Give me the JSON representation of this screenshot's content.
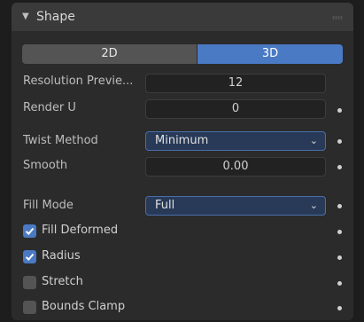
{
  "panel": {
    "title": "Shape",
    "icons": {
      "collapse": "triangle-down-icon",
      "drag": "grip-icon"
    }
  },
  "dimension_toggle": {
    "option_2d": "2D",
    "option_3d": "3D",
    "selected": "3D"
  },
  "resolution_preview": {
    "label": "Resolution Previe...",
    "value": "12"
  },
  "render_u": {
    "label": "Render U",
    "value": "0"
  },
  "twist_method": {
    "label": "Twist Method",
    "value": "Minimum"
  },
  "smooth": {
    "label": "Smooth",
    "value": "0.00"
  },
  "fill_mode": {
    "label": "Fill Mode",
    "value": "Full"
  },
  "checkboxes": [
    {
      "label": "Fill Deformed",
      "checked": true
    },
    {
      "label": "Radius",
      "checked": true
    },
    {
      "label": "Stretch",
      "checked": false
    },
    {
      "label": "Bounds Clamp",
      "checked": false
    }
  ],
  "colors": {
    "accent": "#4a7ac4",
    "panel_bg": "#2b2b2b",
    "header_bg": "#3a3a3a"
  }
}
